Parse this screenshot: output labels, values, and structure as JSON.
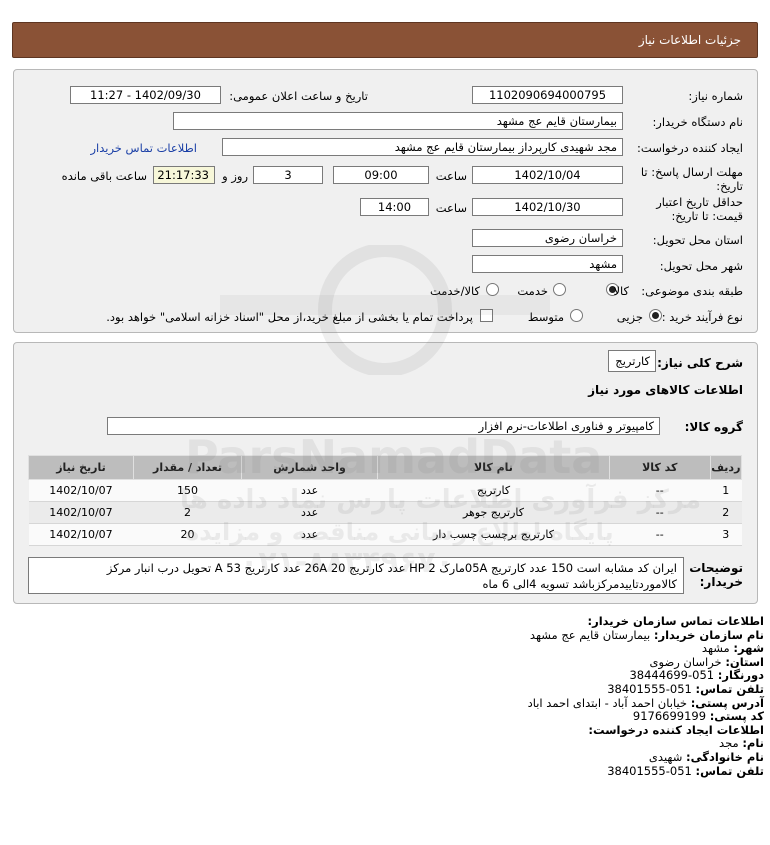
{
  "header": {
    "title": "جزئیات اطلاعات نیاز"
  },
  "form": {
    "need_number_label": "شماره نیاز:",
    "need_number": "1102090694000795",
    "announce_label": "تاریخ و ساعت اعلان عمومی:",
    "announce_value": "1402/09/30 - 11:27",
    "buyer_org_label": "نام دستگاه خریدار:",
    "buyer_org": "بیمارستان قایم  عج  مشهد",
    "creator_label": "ایجاد کننده درخواست:",
    "creator": "مجد شهیدی کارپرداز بیمارستان قایم  عج  مشهد",
    "contact_link": "اطلاعات تماس خریدار",
    "deadline_label_1": "مهلت ارسال پاسخ: تا",
    "deadline_label_2": "تاریخ:",
    "deadline_date": "1402/10/04",
    "time_label": "ساعت",
    "deadline_time": "09:00",
    "days_value": "3",
    "days_label": "روز و",
    "remaining_time": "21:17:33",
    "remaining_label": "ساعت باقی مانده",
    "validity_label_1": "حداقل تاریخ اعتبار",
    "validity_label_2": "قیمت: تا تاریخ:",
    "validity_date": "1402/10/30",
    "validity_time": "14:00",
    "province_label": "استان محل تحویل:",
    "province": "خراسان رضوی",
    "city_label": "شهر محل تحویل:",
    "city": "مشهد",
    "category_label": "طبقه بندی موضوعی:",
    "category_options": [
      "کالا",
      "خدمت",
      "کالا/خدمت"
    ],
    "category_selected": "کالا",
    "process_label": "نوع فرآیند خرید :",
    "process_options": [
      "جزیی",
      "متوسط"
    ],
    "process_selected": "جزیی",
    "payment_note": "پرداخت تمام یا بخشی از مبلغ خرید،از محل \"اسناد خزانه اسلامی\" خواهد بود."
  },
  "need": {
    "summary_label": "شرح کلی نیاز:",
    "summary": "کارتریج",
    "goods_info_title": "اطلاعات کالاهای مورد نیاز",
    "group_label": "گروه کالا:",
    "group": "کامپیوتر و فناوری اطلاعات-نرم افزار",
    "table": {
      "headers": [
        "ردیف",
        "کد کالا",
        "نام کالا",
        "واحد شمارش",
        "تعداد / مقدار",
        "تاریخ نیاز"
      ],
      "rows": [
        [
          "1",
          "--",
          "کارتریج",
          "عدد",
          "150",
          "1402/10/07"
        ],
        [
          "2",
          "--",
          "کارتریج جوهر",
          "عدد",
          "2",
          "1402/10/07"
        ],
        [
          "3",
          "--",
          "کارتریج برچسب چسب دار",
          "عدد",
          "20",
          "1402/10/07"
        ]
      ]
    },
    "desc_label_1": "توضیحات",
    "desc_label_2": "خریدار:",
    "desc_line1": "ایران کد مشابه است 150 عدد کارتریج 05Aمارک HP 2 عدد کارتریج 20 26A عدد کارتریج 53 A تحویل درب انبار مرکز",
    "desc_line2": "کالاموردتاییدمرکزباشد تسویه 4الی 6 ماه"
  },
  "contact": {
    "title": "اطلاعات تماس سازمان خریدار:",
    "org_label": "نام سازمان خریدار:",
    "org": "بیمارستان قایم عج مشهد",
    "city_label": "شهر:",
    "city": "مشهد",
    "province_label": "استان:",
    "province": "خراسان رضوی",
    "fax_label": "دورنگار:",
    "fax": "051-38444699",
    "phone_label": "تلفن تماس:",
    "phone": "051-38401555",
    "address_label": "آدرس پستی:",
    "address": "خیابان احمد آباد - ابتدای احمد اباد",
    "postal_label": "کد پستی:",
    "postal": "9176699199",
    "creator_title": "اطلاعات ایجاد کننده درخواست:",
    "name_label": "نام:",
    "name": "مجد",
    "family_label": "نام خانوادگی:",
    "family": "شهیدی",
    "creator_phone_label": "تلفن تماس:",
    "creator_phone": "051-38401555"
  },
  "watermark": {
    "brand": "ParsNamadData",
    "tagline": "مرکز فرآوری اطلاعات پارس نماد داده ها",
    "tagline2": "پایگاه اطلاع رسانی مناقصه و مزایده",
    "phone": "۰۲۱-۸۸۳۴۹۶۷۰"
  }
}
